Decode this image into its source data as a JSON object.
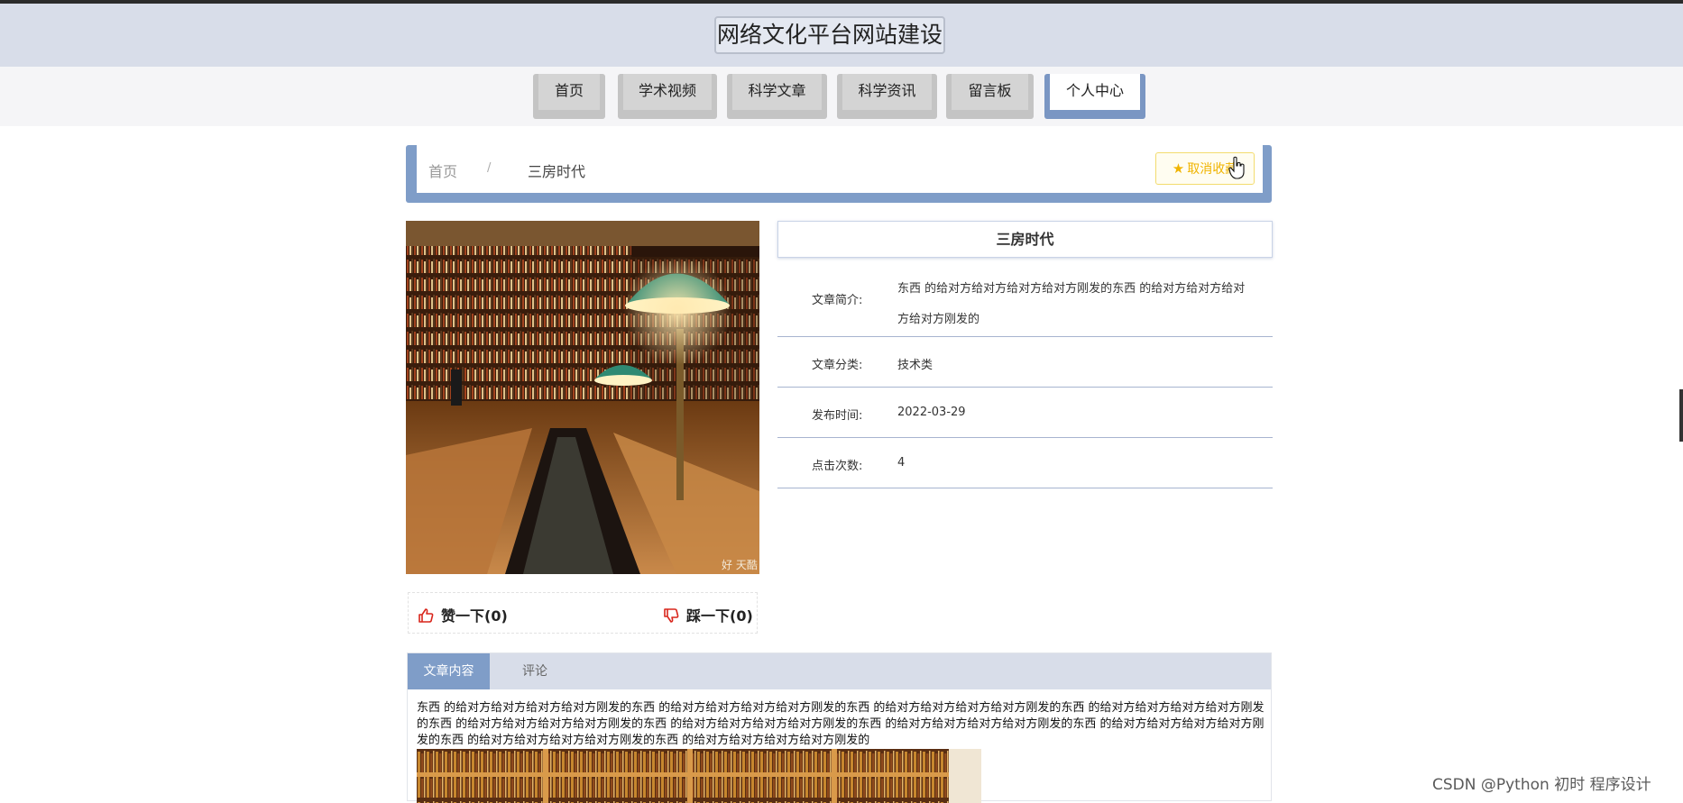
{
  "header": {
    "site_title": "网络文化平台网站建设"
  },
  "nav": {
    "items": [
      {
        "label": "首页"
      },
      {
        "label": "学术视频"
      },
      {
        "label": "科学文章"
      },
      {
        "label": "科学资讯"
      },
      {
        "label": "留言板"
      },
      {
        "label": "个人中心"
      }
    ],
    "active_index": 5
  },
  "breadcrumb": {
    "home": "首页",
    "separator": "/",
    "current": "三房时代"
  },
  "favorite_button": {
    "label": "取消收藏",
    "icon": "star-icon"
  },
  "reactions": {
    "like_label": "赞一下(0)",
    "dislike_label": "踩一下(0)"
  },
  "article": {
    "title": "三房时代",
    "fields": [
      {
        "label": "文章简介:",
        "value": "东西 的给对方给对方给对方给对方刚发的东西 的给对方给对方给对方给对方刚发的"
      },
      {
        "label": "文章分类:",
        "value": "技术类"
      },
      {
        "label": "发布时间:",
        "value": "2022-03-29"
      },
      {
        "label": "点击次数:",
        "value": "4"
      }
    ]
  },
  "tabs": [
    {
      "label": "文章内容"
    },
    {
      "label": "评论"
    }
  ],
  "content": {
    "text": "东西 的给对方给对方给对方给对方刚发的东西 的给对方给对方给对方给对方刚发的东西 的给对方给对方给对方给对方刚发的东西 的给对方给对方给对方给对方刚发的东西 的给对方给对方给对方给对方刚发的东西 的给对方给对方给对方给对方刚发的东西 的给对方给对方给对方给对方刚发的东西 的给对方给对方给对方给对方刚发的东西 的给对方给对方给对方给对方刚发的东西 的给对方给对方给对方给对方刚发的"
  },
  "image_caption": "好 天酷",
  "watermark": "CSDN @Python 初时 程序设计",
  "colors": {
    "accent": "#7f9dc8",
    "header_bg": "#d8dde9",
    "favorite": "#f0b400",
    "like": "#d9261c"
  }
}
